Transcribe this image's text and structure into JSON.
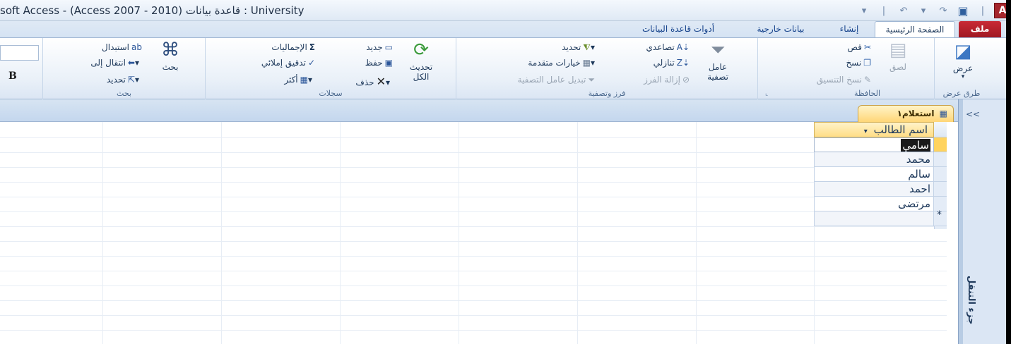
{
  "window": {
    "title": "soft Access - (Access 2007 - 2010) قاعدة بيانات : University",
    "app_icon_letter": "A"
  },
  "tabs": {
    "file": "ملف",
    "home": "الصفحة الرئيسية",
    "create": "إنشاء",
    "external": "بيانات خارجية",
    "database_tools": "أدوات قاعدة البيانات"
  },
  "ribbon": {
    "views": {
      "view_label": "عرض",
      "group_label": "طرق عرض"
    },
    "clipboard": {
      "paste": "لصق",
      "cut": "قص",
      "copy": "نسخ",
      "format_painter": "نسخ التنسيق",
      "group_label": "الحافظة"
    },
    "sort_filter": {
      "filter_line1": "عامل",
      "filter_line2": "تصفية",
      "ascending": "تصاعدي",
      "descending": "تنازلي",
      "remove_sort": "إزالة الفرز",
      "selection": "تحديد",
      "advanced": "خيارات متقدمة",
      "toggle_filter": "تبديل عامل التصفية",
      "group_label": "فرز وتصفية"
    },
    "records": {
      "refresh_line1": "تحديث",
      "refresh_line2": "الكل",
      "new": "جديد",
      "save": "حفظ",
      "delete": "حذف",
      "totals": "الإجماليات",
      "spelling": "تدقيق إملائي",
      "more": "أكثر",
      "group_label": "سجلات"
    },
    "find": {
      "find": "بحث",
      "replace": "استبدال",
      "goto": "انتقال إلى",
      "select": "تحديد",
      "group_label": "بحث"
    },
    "text_formatting": {
      "bold": "B"
    }
  },
  "document": {
    "tab_title": "استعلام١",
    "column_header": "اسم الطالب",
    "rows": [
      "سامي",
      "محمد",
      "سالم",
      "احمد",
      "مرتضى"
    ],
    "new_row_marker": "*"
  },
  "nav_pane": {
    "toggle": "<<",
    "label": "جزء التنقل"
  }
}
